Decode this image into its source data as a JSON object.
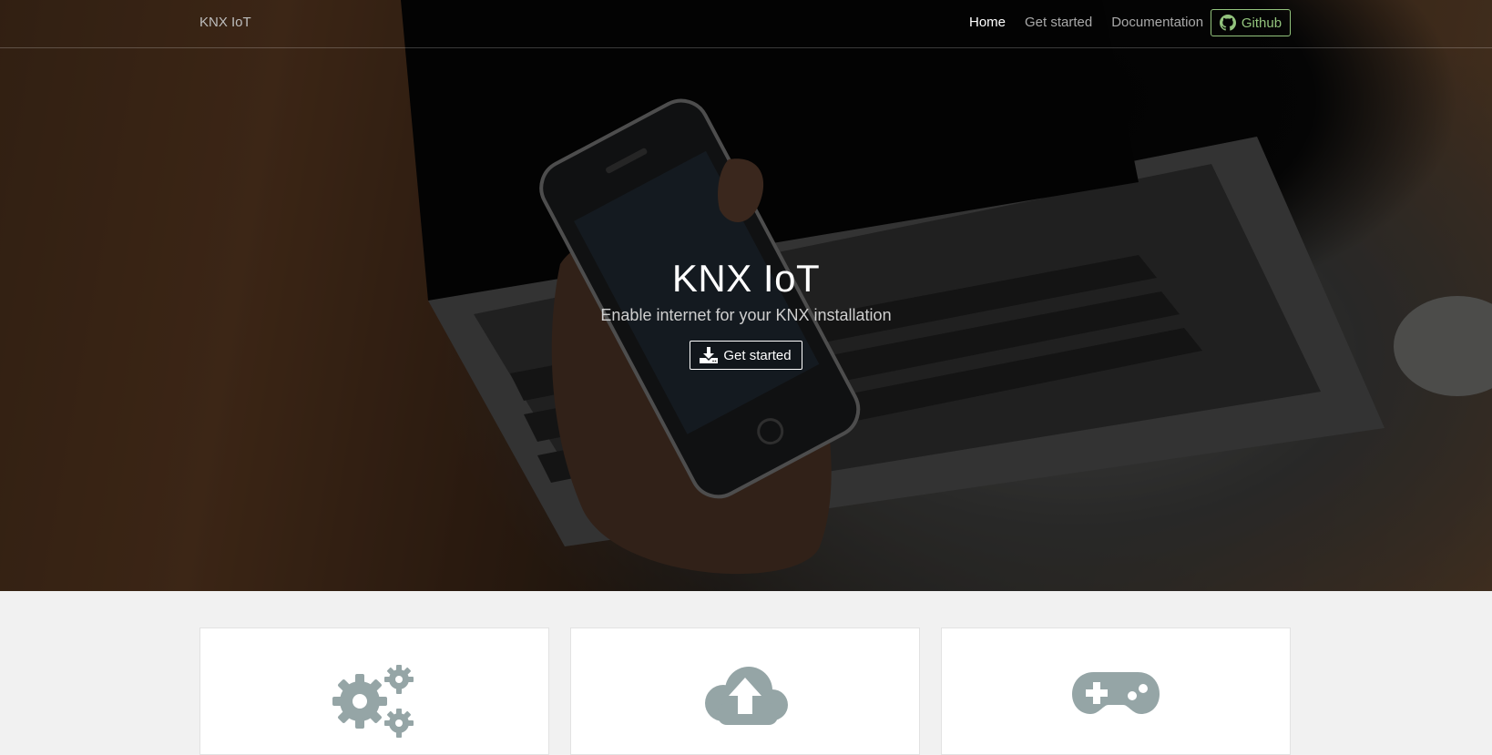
{
  "navbar": {
    "brand": "KNX IoT",
    "links": [
      {
        "label": "Home",
        "active": true
      },
      {
        "label": "Get started",
        "active": false
      },
      {
        "label": "Documentation",
        "active": false
      }
    ],
    "github_label": "Github",
    "github_icon": "github-icon",
    "accent_color": "#93c47d"
  },
  "hero": {
    "title": "KNX IoT",
    "subtitle": "Enable internet for your KNX installation",
    "cta_label": "Get started",
    "cta_icon": "download-icon"
  },
  "features": [
    {
      "icon": "gears-icon"
    },
    {
      "icon": "cloud-upload-icon"
    },
    {
      "icon": "gamepad-icon"
    }
  ],
  "colors": {
    "feature_icon": "#95a5a6",
    "section_background": "#f1f1f1"
  }
}
